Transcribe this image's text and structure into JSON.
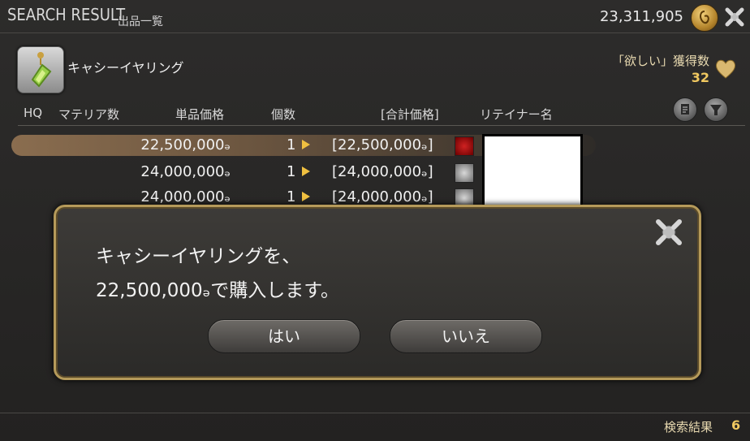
{
  "window": {
    "title": "SEARCH RESULT",
    "subtitle": "出品一覧",
    "gil": "23,311,905"
  },
  "item": {
    "name": "キャシーイヤリング",
    "wishlist_label": "「欲しい」獲得数",
    "wishlist_count": "32"
  },
  "columns": {
    "hq": "HQ",
    "materia": "マテリア数",
    "unit_price": "単品価格",
    "quantity": "個数",
    "total_price": "[合計価格]",
    "retainer": "リテイナー名"
  },
  "listings": [
    {
      "unit_price": "22,500,000ₔ",
      "quantity": "1",
      "total": "[22,500,000ₔ]",
      "icon": "red-emblem-icon"
    },
    {
      "unit_price": "24,000,000ₔ",
      "quantity": "1",
      "total": "[24,000,000ₔ]",
      "icon": "grey-emblem-icon"
    },
    {
      "unit_price": "24,000,000ₔ",
      "quantity": "1",
      "total": "[24,000,000ₔ]",
      "icon": "grey-emblem-icon"
    }
  ],
  "dialog": {
    "line1": "キャシーイヤリングを、",
    "line2": "22,500,000ₔで購入します。",
    "yes": "はい",
    "no": "いいえ"
  },
  "footer": {
    "result_label": "検索結果",
    "result_count": "6"
  },
  "colors": {
    "accent_gold": "#f0c860",
    "dialog_border": "#b59a5a",
    "selected_row": "#8a6d4f"
  }
}
